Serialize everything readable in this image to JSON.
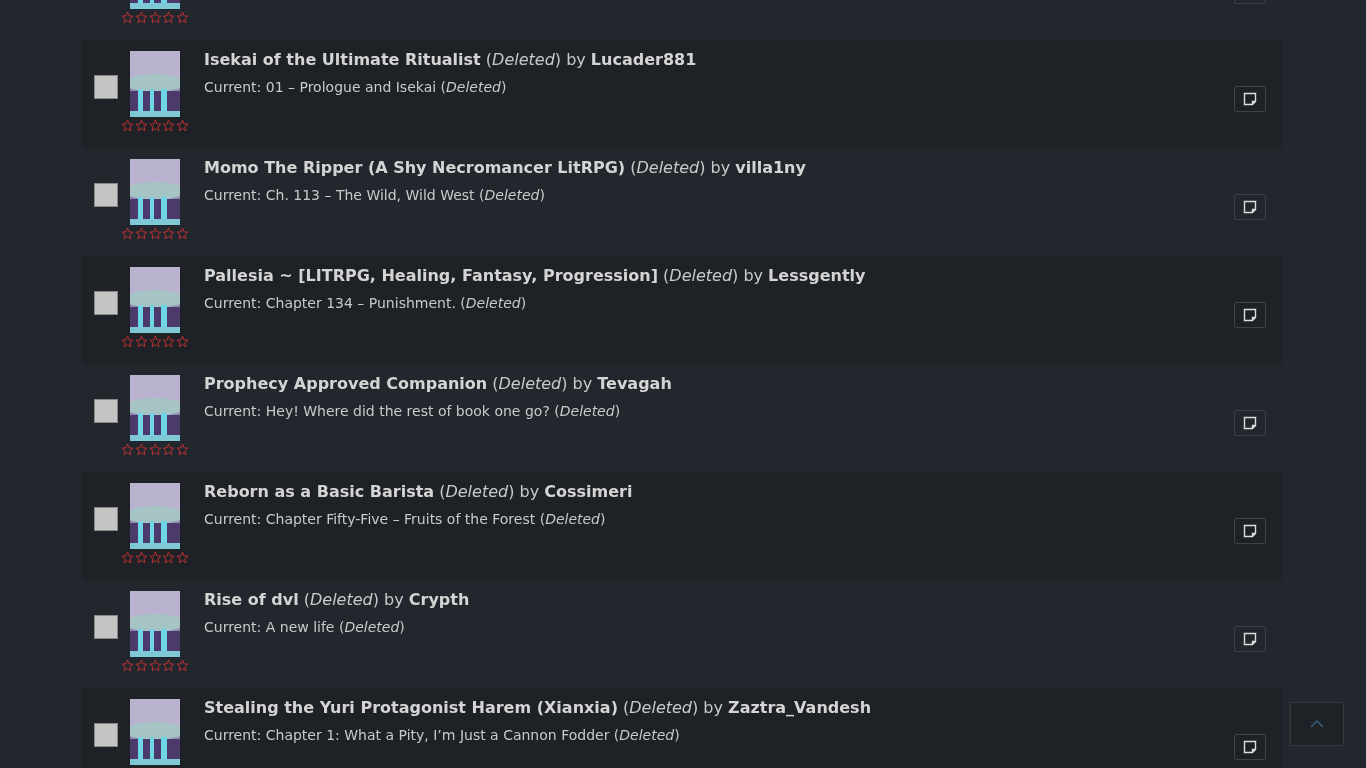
{
  "rows": [
    {
      "kind": "cut_off",
      "stars": 0
    },
    {
      "kind": "story",
      "checked": false,
      "heading": "**Isekai of the Ultimate Ritualist** (*Deleted*) by **Lucader881**",
      "current": "Current: 01 – Prologue and Isekai (*Deleted*)",
      "stars": 0
    },
    {
      "kind": "story",
      "checked": false,
      "heading": "**Momo The Ripper (A Shy Necromancer LitRPG)** (*Deleted*) by **villa1ny**",
      "current": "Current: Ch. 113 – The Wild, Wild West (*Deleted*)",
      "stars": 0
    },
    {
      "kind": "story",
      "checked": false,
      "heading": "**Pallesia ~ [LITRPG, Healing, Fantasy, Progression]** (*Deleted*) by **Lessgently**",
      "current": "Current: Chapter 134 – Punishment. (*Deleted*)",
      "stars": 0
    },
    {
      "kind": "story",
      "checked": false,
      "heading": "**Prophecy Approved Companion** (*Deleted*) by **Tevagah**",
      "current": "Current: Hey! Where did the rest of book one go? (*Deleted*)",
      "stars": 0
    },
    {
      "kind": "story",
      "checked": false,
      "heading": "**Reborn as a Basic Barista** (*Deleted*) by **Cossimeri**",
      "current": "Current: Chapter Fifty-Five – Fruits of the Forest (*Deleted*)",
      "stars": 0
    },
    {
      "kind": "story",
      "checked": false,
      "heading": "**Rise of dvl** (*Deleted*) by **Crypth**",
      "current": "Current: A new life (*Deleted*)",
      "stars": 0
    },
    {
      "kind": "story",
      "checked": false,
      "heading": "**Stealing the Yuri Protagonist Harem (Xianxia)** (*Deleted*) by **Zaztra_Vandesh**",
      "current": "Current: Chapter 1: What a Pity, I’m Just a Cannon Fodder (*Deleted*)"
    }
  ]
}
